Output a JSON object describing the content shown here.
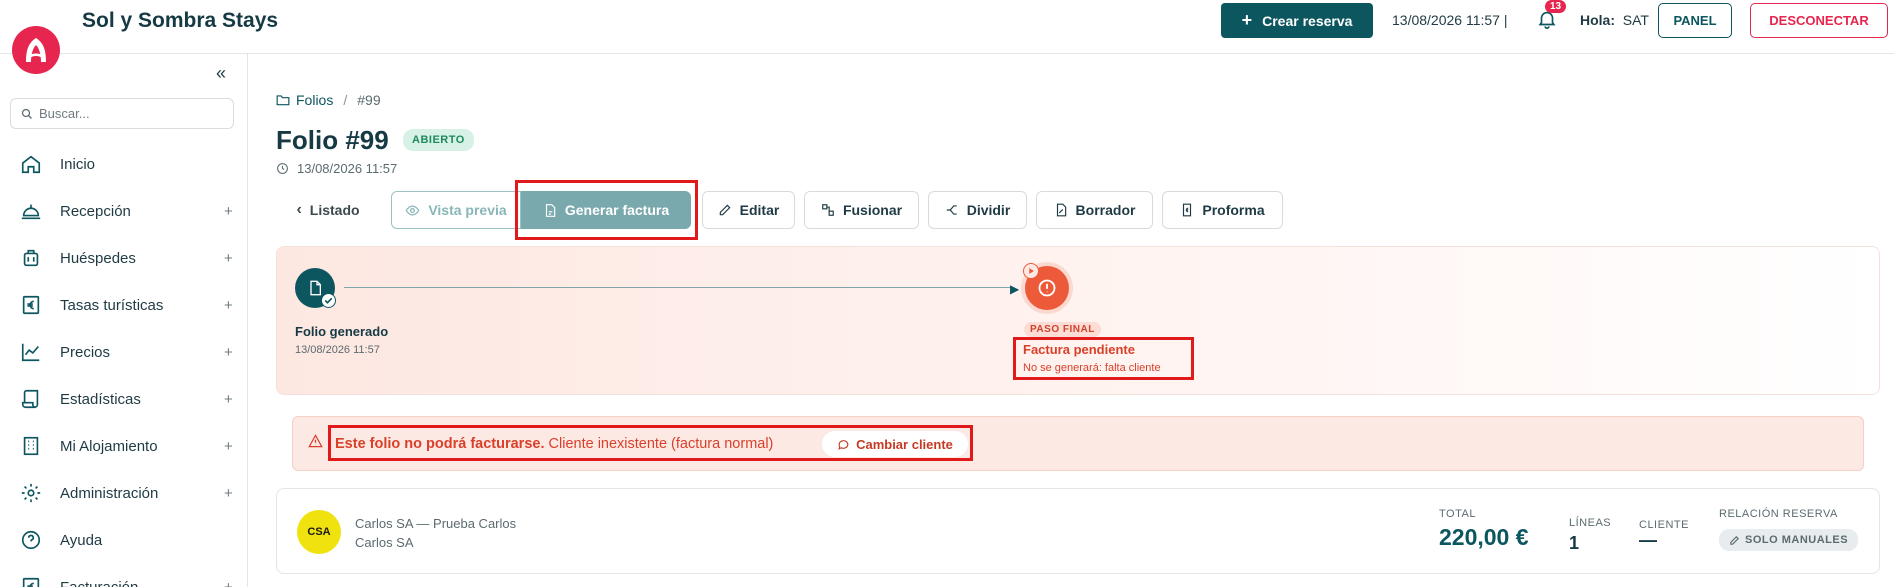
{
  "app": {
    "title": "Sol y Sombra Stays"
  },
  "header": {
    "create_label": "Crear reserva",
    "datetime": "13/08/2026 11:57 |",
    "notifications": "13",
    "greeting": "Hola:",
    "user": "SAT",
    "panel_label": "PANEL",
    "logout_label": "DESCONECTAR"
  },
  "sidebar": {
    "search_placeholder": "Buscar...",
    "items": [
      {
        "label": "Inicio",
        "icon": "home-icon",
        "expandable": false
      },
      {
        "label": "Recepción",
        "icon": "bell-desk-icon",
        "expandable": true
      },
      {
        "label": "Huéspedes",
        "icon": "luggage-icon",
        "expandable": true
      },
      {
        "label": "Tasas turísticas",
        "icon": "euro-icon",
        "expandable": true
      },
      {
        "label": "Precios",
        "icon": "chart-line-icon",
        "expandable": true
      },
      {
        "label": "Estadísticas",
        "icon": "scroll-icon",
        "expandable": true
      },
      {
        "label": "Mi Alojamiento",
        "icon": "building-icon",
        "expandable": true
      },
      {
        "label": "Administración",
        "icon": "gear-icon",
        "expandable": true
      },
      {
        "label": "Ayuda",
        "icon": "help-icon",
        "expandable": false
      },
      {
        "label": "Facturación",
        "icon": "euro-icon",
        "expandable": true
      }
    ],
    "plus": "+"
  },
  "breadcrumb": {
    "root": "Folios",
    "sep": "/",
    "current": "#99"
  },
  "folio": {
    "title": "Folio #99",
    "status": "ABIERTO",
    "date": "13/08/2026 11:57"
  },
  "toolbar": {
    "listado": "Listado",
    "preview": "Vista previa",
    "generate": "Generar factura",
    "edit": "Editar",
    "merge": "Fusionar",
    "split": "Dividir",
    "draft": "Borrador",
    "proforma": "Proforma"
  },
  "timeline": {
    "step1_label": "Folio generado",
    "step1_date": "13/08/2026 11:57",
    "final_badge": "PASO FINAL",
    "step2_label": "Factura pendiente",
    "step2_sub": "No se generará: falta cliente"
  },
  "alert": {
    "strong": "Este folio no podrá facturarse.",
    "text": "Cliente inexistente (factura normal)",
    "button": "Cambiar cliente"
  },
  "summary": {
    "avatar": "CSA",
    "name": "Carlos SA — Prueba Carlos",
    "subname": "Carlos SA",
    "total_label": "TOTAL",
    "total": "220,00 €",
    "lines_label": "LÍNEAS",
    "lines": "1",
    "client_label": "CLIENTE",
    "client": "—",
    "relation_label": "RELACIÓN RESERVA",
    "relation": "SOLO MANUALES"
  },
  "colors": {
    "brand": "#e6264e",
    "primary": "#0c5660",
    "danger": "#d9402a",
    "warning_bg": "#fde9e4"
  }
}
